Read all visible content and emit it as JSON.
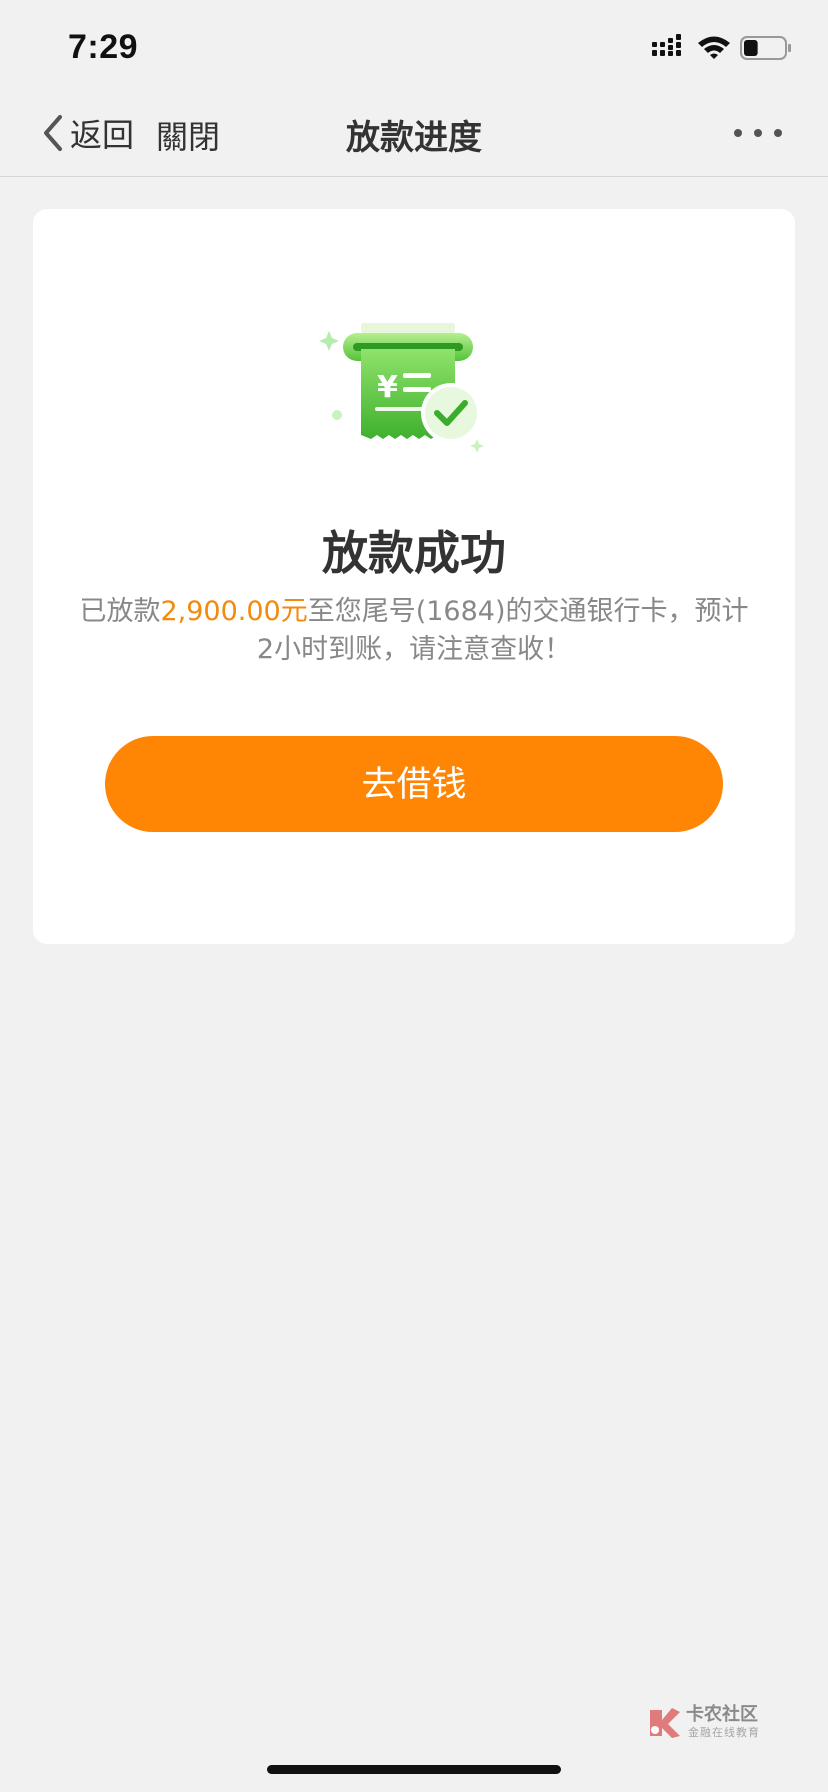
{
  "status_bar": {
    "time": "7:29",
    "battery_level": 0.35
  },
  "nav": {
    "back_label": "返回",
    "close_label": "關閉",
    "title": "放款进度",
    "more_icon": "more-dots-icon"
  },
  "result": {
    "icon": "receipt-check-icon",
    "title": "放款成功",
    "desc_prefix": "已放款",
    "amount": "2,900.00元",
    "desc_middle": "至您尾号(1684)的交通银行卡，预计2小时到账，请注意查收！"
  },
  "actions": {
    "borrow_label": "去借钱"
  },
  "watermark": {
    "name": "卡农社区",
    "tagline": "金融在线教育"
  },
  "colors": {
    "accent": "#ff8505",
    "amount": "#f28a0c",
    "success": "#5cc43c",
    "background": "#f1f1f2"
  }
}
